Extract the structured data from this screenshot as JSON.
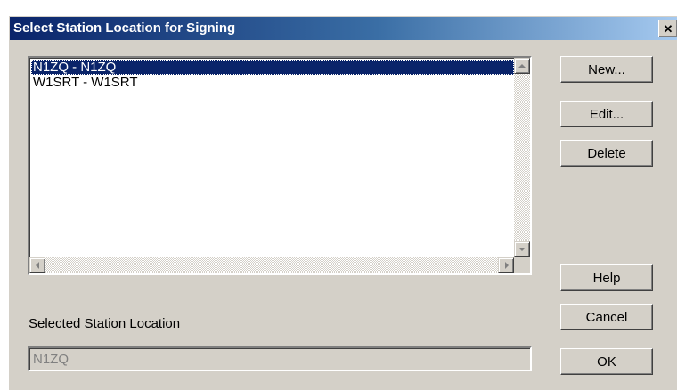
{
  "window": {
    "title": "Select Station Location for Signing",
    "close_glyph": "✕"
  },
  "stations": {
    "items": [
      {
        "label": "N1ZQ - N1ZQ",
        "selected": true
      },
      {
        "label": "W1SRT - W1SRT",
        "selected": false
      }
    ]
  },
  "buttons": {
    "new": "New...",
    "edit": "Edit...",
    "delete": "Delete",
    "help": "Help",
    "cancel": "Cancel",
    "ok": "OK"
  },
  "selected_location": {
    "label": "Selected Station Location",
    "value": "N1ZQ"
  },
  "colors": {
    "title_bar_start": "#0a246a",
    "title_bar_end": "#a6caf0",
    "selection": "#0a246a",
    "face": "#d4d0c8"
  },
  "icons": [
    "close-icon",
    "scroll-up-icon",
    "scroll-down-icon",
    "scroll-left-icon",
    "scroll-right-icon"
  ]
}
